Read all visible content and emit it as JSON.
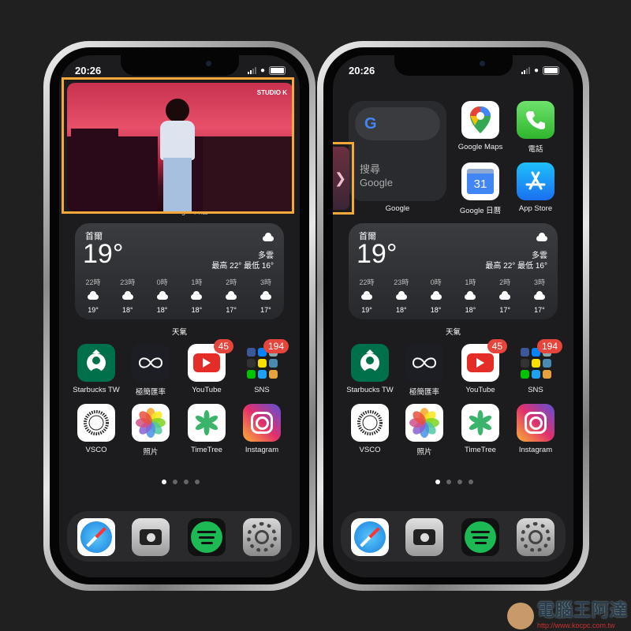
{
  "status": {
    "time": "20:26"
  },
  "left_phone": {
    "video_watermark": "STUDIO K",
    "hidden_labels": [
      "Google",
      "Google 日曆",
      "App Store"
    ]
  },
  "right_phone": {
    "side_tab_icon": "chevron-right-icon",
    "google_widget": {
      "search_text_1": "搜尋",
      "search_text_2": "Google",
      "label": "Google"
    },
    "top_apps": [
      {
        "label": "Google Maps",
        "icon": "google-maps-icon"
      },
      {
        "label": "電話",
        "icon": "phone-icon"
      },
      {
        "label": "Google 日曆",
        "icon": "google-calendar-icon",
        "day": "31"
      },
      {
        "label": "App Store",
        "icon": "app-store-icon"
      }
    ]
  },
  "weather": {
    "city": "首爾",
    "temp": "19°",
    "condition": "多雲",
    "high_low": "最高 22° 最低 16°",
    "hours": [
      {
        "h": "22時",
        "t": "19°"
      },
      {
        "h": "23時",
        "t": "18°"
      },
      {
        "h": "0時",
        "t": "18°"
      },
      {
        "h": "1時",
        "t": "18°"
      },
      {
        "h": "2時",
        "t": "17°"
      },
      {
        "h": "3時",
        "t": "17°"
      }
    ],
    "widget_label": "天氣"
  },
  "apps": [
    {
      "label": "Starbucks TW",
      "icon": "starbucks-icon",
      "color": "#00704a"
    },
    {
      "label": "極簡匯率",
      "icon": "infinity-icon",
      "color": "#1c1e24"
    },
    {
      "label": "YouTube",
      "icon": "youtube-icon",
      "color": "#ffffff",
      "badge": "45"
    },
    {
      "label": "SNS",
      "icon": "folder-icon",
      "color": "transparent",
      "badge": "194"
    },
    {
      "label": "VSCO",
      "icon": "vsco-icon",
      "color": "#ffffff"
    },
    {
      "label": "照片",
      "icon": "photos-icon",
      "color": "#ffffff"
    },
    {
      "label": "TimeTree",
      "icon": "timetree-icon",
      "color": "#ffffff"
    },
    {
      "label": "Instagram",
      "icon": "instagram-icon",
      "color": "#c13584"
    }
  ],
  "page_dots": {
    "count": 4,
    "active": 0
  },
  "dock": [
    {
      "icon": "safari-icon"
    },
    {
      "icon": "camera-icon"
    },
    {
      "icon": "spotify-icon"
    },
    {
      "icon": "settings-icon"
    }
  ],
  "watermark": {
    "title": "電腦王阿達",
    "url": "http://www.kocpc.com.tw"
  }
}
